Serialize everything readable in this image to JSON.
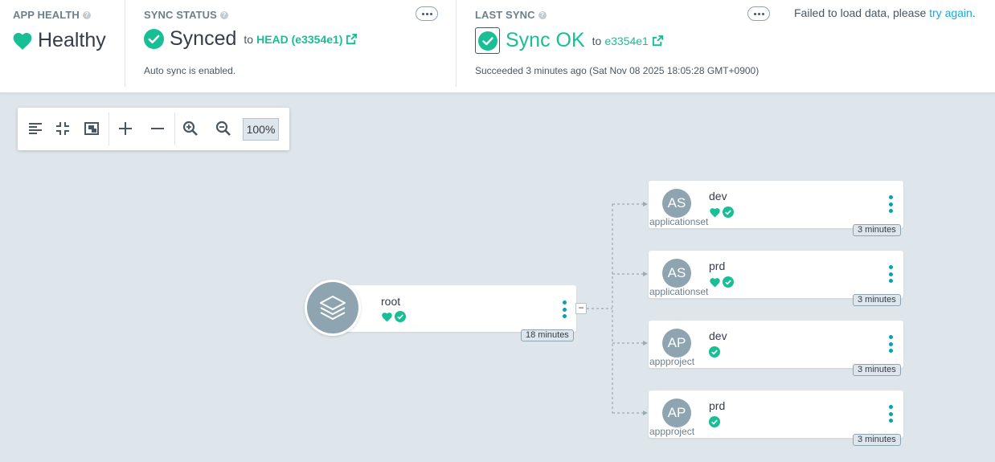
{
  "header": {
    "app_health": {
      "title": "APP HEALTH",
      "status": "Healthy"
    },
    "sync_status": {
      "title": "SYNC STATUS",
      "status": "Synced",
      "to_label": "to",
      "revision": "HEAD (e3354e1)",
      "sub_text": "Auto sync is enabled."
    },
    "last_sync": {
      "title": "LAST SYNC",
      "status": "Sync OK",
      "to_label": "to",
      "revision": "e3354e1",
      "sub_text": "Succeeded 3 minutes ago (Sat Nov 08 2025 18:05:28 GMT+0900)"
    },
    "error": {
      "text": "Failed to load data, please",
      "link": "try again",
      "suffix": "."
    },
    "help_icon_text": "?"
  },
  "toolbar": {
    "zoom": "100%",
    "icons": [
      "align-left-icon",
      "compress-icon",
      "fit-screen-icon",
      "plus-icon",
      "minus-icon",
      "zoom-in-icon",
      "zoom-out-icon"
    ]
  },
  "graph": {
    "root": {
      "name": "root",
      "age": "18 minutes",
      "collapse": "−"
    },
    "children": [
      {
        "avatar": "AS",
        "name": "dev",
        "kind": "applicationset",
        "age": "3 minutes",
        "health": true
      },
      {
        "avatar": "AS",
        "name": "prd",
        "kind": "applicationset",
        "age": "3 minutes",
        "health": true
      },
      {
        "avatar": "AP",
        "name": "dev",
        "kind": "appproject",
        "age": "3 minutes",
        "health": false
      },
      {
        "avatar": "AP",
        "name": "prd",
        "kind": "appproject",
        "age": "3 minutes",
        "health": false
      }
    ]
  },
  "colors": {
    "green": "#18be94",
    "teal": "#0a9fb3",
    "link": "#0dadea",
    "canvas": "#dee6eb",
    "avatar": "#8fa4b1"
  }
}
